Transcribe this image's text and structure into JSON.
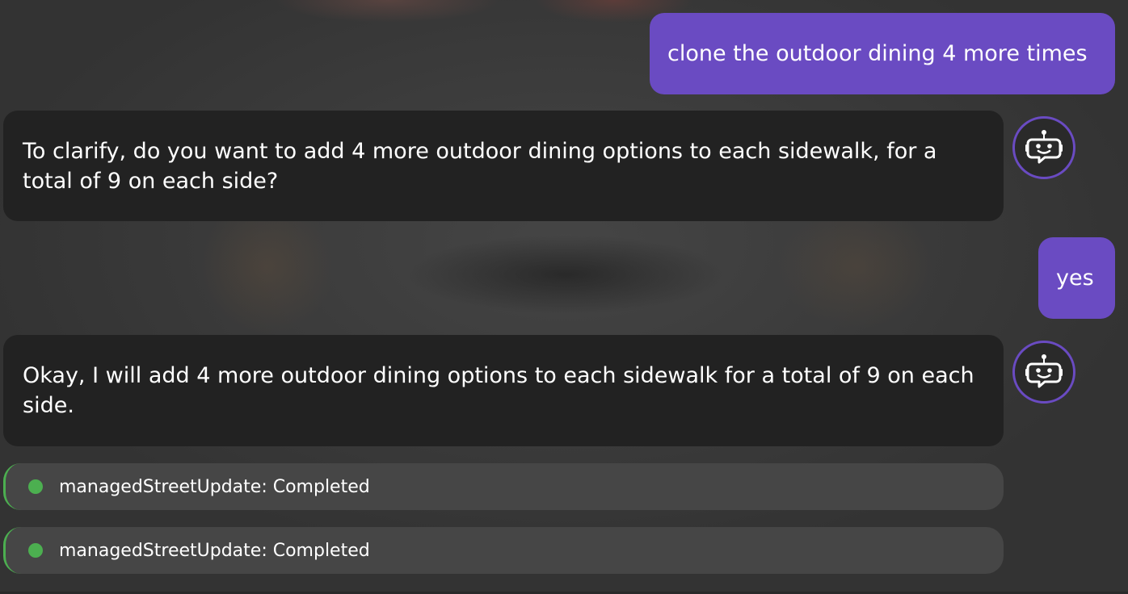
{
  "theme": {
    "user_bubble_color": "#6a4bc2",
    "bot_bubble_color": "#222222",
    "status_color": "#4caf50",
    "avatar_icon": "robot-chat-icon"
  },
  "messages": [
    {
      "role": "user",
      "text": "clone the outdoor dining 4 more times"
    },
    {
      "role": "assistant",
      "text": "To clarify, do you want to add 4 more outdoor dining options to each sidewalk, for a total of 9 on each side?"
    },
    {
      "role": "user",
      "text": "yes"
    },
    {
      "role": "assistant",
      "text": "Okay, I will add 4 more outdoor dining options to each sidewalk for a total of 9 on each side."
    }
  ],
  "statuses": [
    {
      "text": "managedStreetUpdate: Completed"
    },
    {
      "text": "managedStreetUpdate: Completed"
    }
  ]
}
